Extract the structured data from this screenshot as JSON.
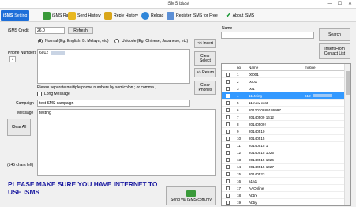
{
  "window": {
    "title": "iSMS blast",
    "minimize": "—",
    "maximize": "☐",
    "close": "✕"
  },
  "toolbar": {
    "items": [
      {
        "label": "Setting",
        "icon": "isms-logo-icon"
      },
      {
        "label": "iSMS Rate",
        "icon": "rate-icon"
      },
      {
        "label": "Send History",
        "icon": "send-history-icon"
      },
      {
        "label": "Reply History",
        "icon": "reply-history-icon"
      },
      {
        "label": "Reload",
        "icon": "reload-icon"
      },
      {
        "label": "Register iSMS for Free",
        "icon": "register-icon"
      },
      {
        "label": "About iSMS",
        "icon": "about-icon"
      }
    ],
    "logo_text": "iSMS"
  },
  "credit": {
    "label": "iSMS Credit",
    "value": "26.0",
    "refresh": "Refresh"
  },
  "mode": {
    "normal": "Normal (Eg. English, B. Melayu, etc)",
    "unicode": "Unicode (Eg. Chinese, Japanese, etc)",
    "selected": "normal"
  },
  "phone": {
    "label": "Phone Numbers",
    "value": "6012",
    "count": "1",
    "hint": "Please separate multiple phone numbers by semicolon ; or comma ,"
  },
  "long_message": {
    "label": "Long Message",
    "checked": false
  },
  "campaign": {
    "label": "Campaign",
    "value": "test SMS campaign"
  },
  "message": {
    "label": "Message",
    "value": "testing",
    "chars_left": "(145 chars left)",
    "clear_all": "Clear All"
  },
  "middle_buttons": {
    "insert": "<< Insert",
    "clear_select": "Clear Select",
    "return": ">> Return",
    "clear_phones": "Clear Phones"
  },
  "send_button": "Send via iSMS.com.my",
  "warning": "PLEASE MAKE SURE YOU HAVE INTERNET TO USE iSMS",
  "contacts": {
    "search_label": "Name",
    "search_value": "",
    "search_button": "Search",
    "insert_button": "Insert From Contact List",
    "columns": [
      "no",
      "Name",
      "mobile"
    ],
    "rows": [
      {
        "no": "1",
        "name": "00001",
        "mobile": ""
      },
      {
        "no": "2",
        "name": "0001",
        "mobile": ""
      },
      {
        "no": "3",
        "name": "001",
        "mobile": ""
      },
      {
        "no": "4",
        "name": "111Ming",
        "mobile": "612",
        "selected": true
      },
      {
        "no": "5",
        "name": "11 new cust",
        "mobile": ""
      },
      {
        "no": "6",
        "name": "2012030889186997",
        "mobile": ""
      },
      {
        "no": "7",
        "name": "20140509 1612",
        "mobile": ""
      },
      {
        "no": "8",
        "name": "20140509!",
        "mobile": ""
      },
      {
        "no": "9",
        "name": "20140510",
        "mobile": ""
      },
      {
        "no": "10",
        "name": "20140515",
        "mobile": ""
      },
      {
        "no": "11",
        "name": "20140515 1",
        "mobile": ""
      },
      {
        "no": "12",
        "name": "20140515 1025",
        "mobile": ""
      },
      {
        "no": "13",
        "name": "20140515 1026",
        "mobile": ""
      },
      {
        "no": "14",
        "name": "20140515 1027",
        "mobile": ""
      },
      {
        "no": "15",
        "name": "20140523",
        "mobile": ""
      },
      {
        "no": "16",
        "name": "a1a1",
        "mobile": ""
      },
      {
        "no": "17",
        "name": "AAOnline",
        "mobile": ""
      },
      {
        "no": "18",
        "name": "AbbY",
        "mobile": ""
      },
      {
        "no": "19",
        "name": "Abby",
        "mobile": ""
      }
    ]
  },
  "colors": {
    "accent": "#1e6fd9",
    "selection": "#3399ff",
    "warning": "#1a1aa0"
  }
}
